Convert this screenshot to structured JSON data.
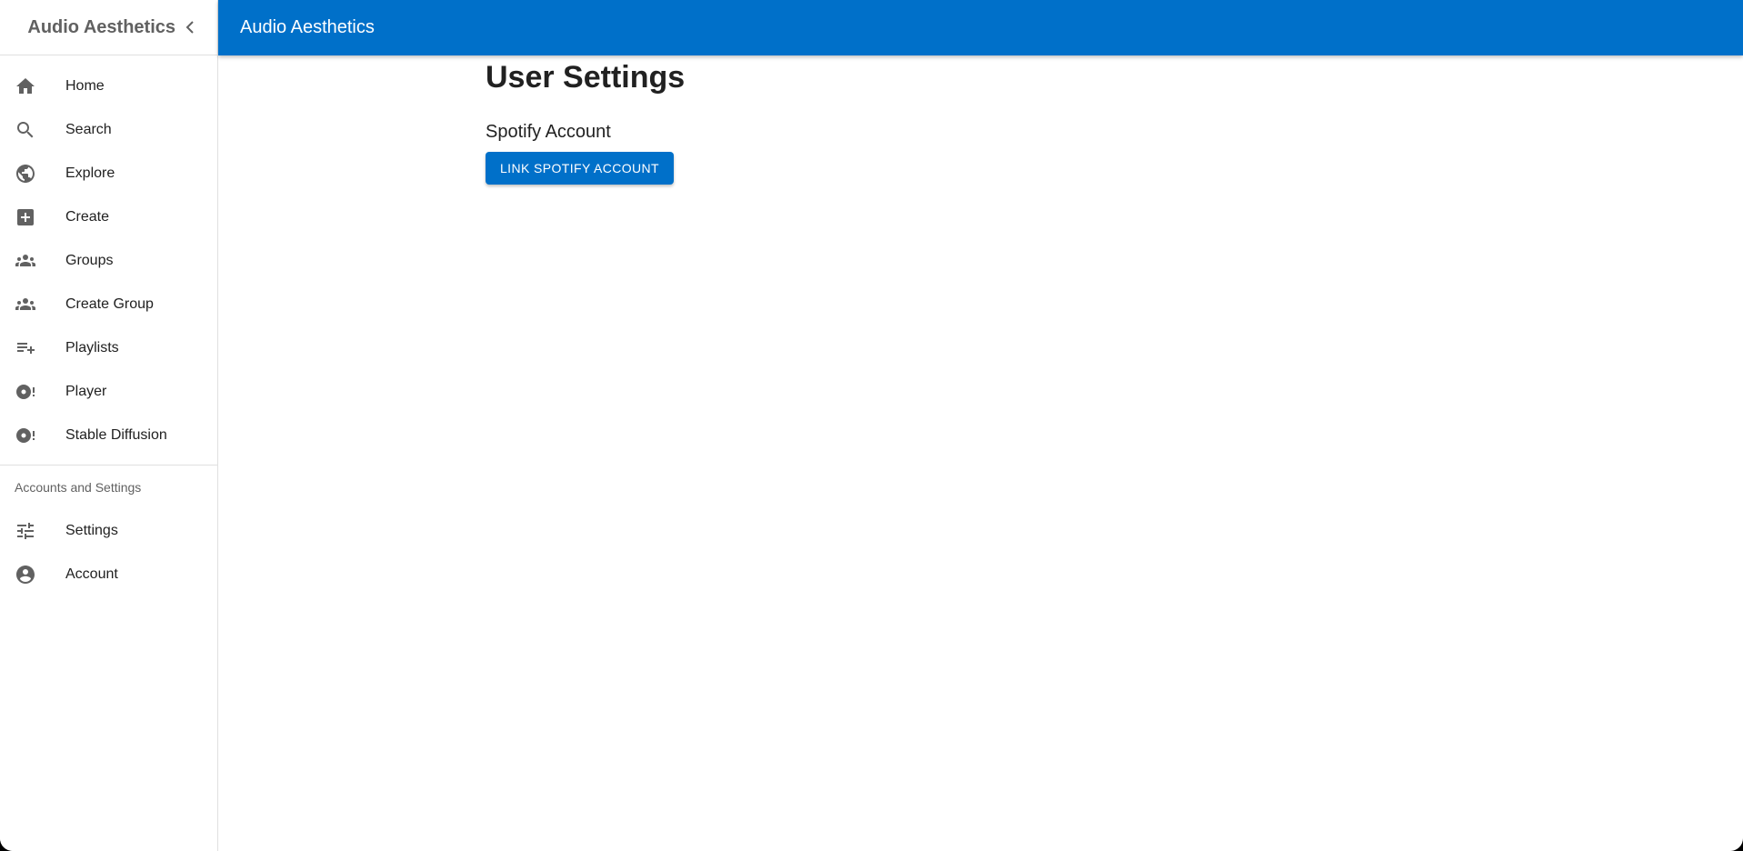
{
  "sidebar": {
    "title": "Audio Aesthetics",
    "items": [
      {
        "label": "Home",
        "icon": "home-icon"
      },
      {
        "label": "Search",
        "icon": "search-icon"
      },
      {
        "label": "Explore",
        "icon": "globe-icon"
      },
      {
        "label": "Create",
        "icon": "add-box-icon"
      },
      {
        "label": "Groups",
        "icon": "groups-icon"
      },
      {
        "label": "Create Group",
        "icon": "groups-icon"
      },
      {
        "label": "Playlists",
        "icon": "playlist-add-icon"
      },
      {
        "label": "Player",
        "icon": "album-icon"
      },
      {
        "label": "Stable Diffusion",
        "icon": "album-icon"
      }
    ],
    "section_label": "Accounts and Settings",
    "account_items": [
      {
        "label": "Settings",
        "icon": "tune-icon"
      },
      {
        "label": "Account",
        "icon": "account-circle-icon"
      }
    ]
  },
  "appbar": {
    "title": "Audio Aesthetics"
  },
  "main": {
    "page_title": "User Settings",
    "section_title": "Spotify Account",
    "link_button_label": "LINK SPOTIFY ACCOUNT"
  },
  "colors": {
    "primary": "#0070c9",
    "icon_gray": "#616161"
  }
}
